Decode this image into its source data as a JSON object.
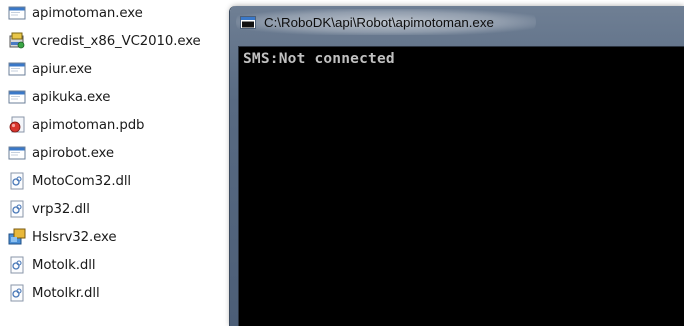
{
  "files": [
    {
      "name": "apimotoman.exe",
      "icon": "exe-window-icon"
    },
    {
      "name": "vcredist_x86_VC2010.exe",
      "icon": "installer-icon"
    },
    {
      "name": "apiur.exe",
      "icon": "exe-window-icon"
    },
    {
      "name": "apikuka.exe",
      "icon": "exe-window-icon"
    },
    {
      "name": "apimotoman.pdb",
      "icon": "pdb-file-icon"
    },
    {
      "name": "apirobot.exe",
      "icon": "exe-window-icon"
    },
    {
      "name": "MotoCom32.dll",
      "icon": "dll-file-icon"
    },
    {
      "name": "vrp32.dll",
      "icon": "dll-file-icon"
    },
    {
      "name": "Hslsrv32.exe",
      "icon": "service-exe-icon"
    },
    {
      "name": "Motolk.dll",
      "icon": "dll-file-icon"
    },
    {
      "name": "Motolkr.dll",
      "icon": "dll-file-icon"
    }
  ],
  "console": {
    "title": "C:\\RoboDK\\api\\Robot\\apimotoman.exe",
    "output": "SMS:Not connected",
    "background": "#000000",
    "text_color": "#c0c0c0"
  }
}
